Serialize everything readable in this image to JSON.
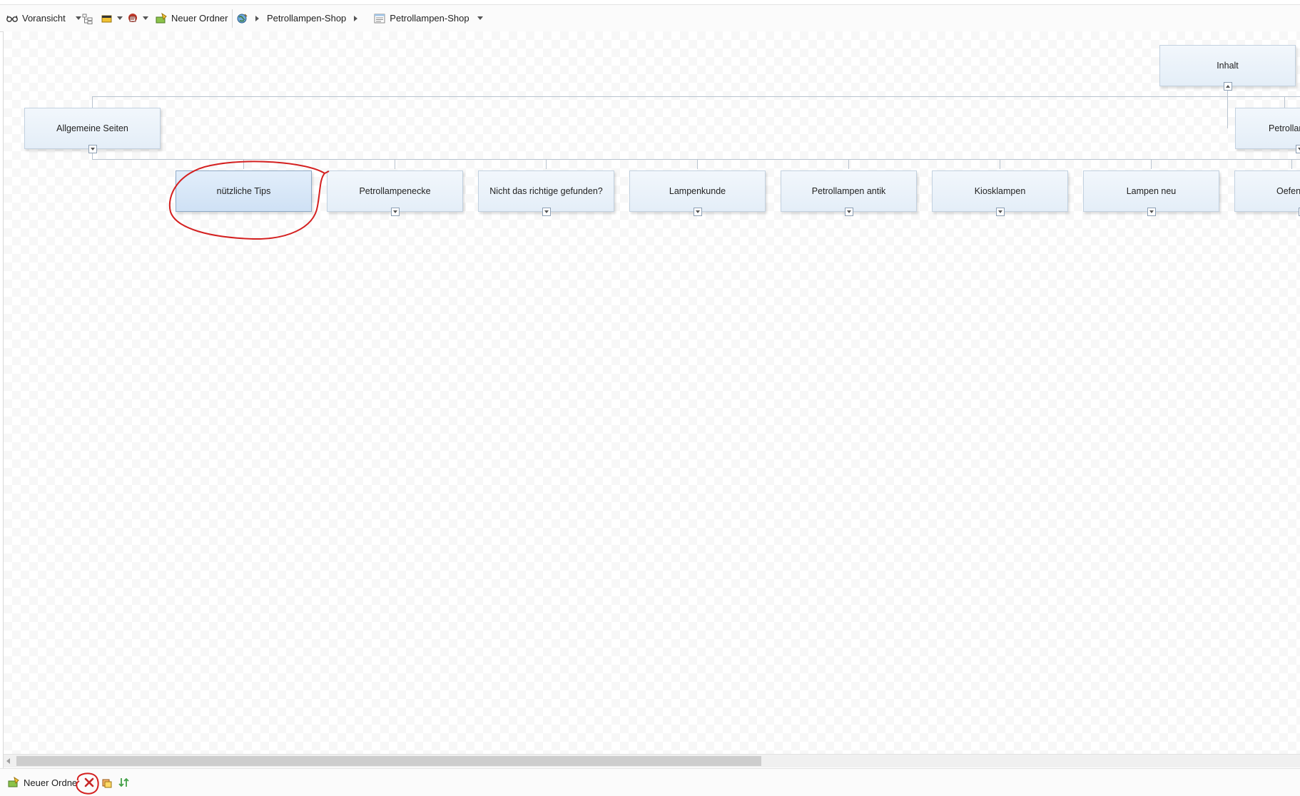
{
  "toolbar": {
    "preview_label": "Voransicht",
    "preview_icon": "glasses-icon",
    "sitemap_icon": "tree-view-icon",
    "folder_icon": "folder-icon",
    "page_icon": "page-icon",
    "new_folder_label": "Neuer Ordner",
    "new_folder_icon": "new-folder-icon",
    "breadcrumb": [
      {
        "label": "Petrollampen-Shop",
        "icon": "globe-icon"
      },
      {
        "label": "Petrollampen-Shop",
        "icon": "document-list-icon"
      }
    ]
  },
  "tree": {
    "root": {
      "label": "Inhalt"
    },
    "level1": [
      "Allgemeine Seiten",
      "Petrollam"
    ],
    "level2": [
      "nützliche Tips",
      "Petrollampenecke",
      "Nicht das richtige gefunden?",
      "Lampenkunde",
      "Petrollampen antik",
      "Kiosklampen",
      "Lampen neu",
      "Oefen"
    ],
    "selected": "nützliche Tips"
  },
  "bottombar": {
    "new_folder_label": "Neuer Ordne",
    "new_folder_icon": "new-folder-icon",
    "delete_icon": "delete-x-icon",
    "copy_icon": "copy-icon",
    "sort_icon": "sort-up-down-icon"
  },
  "annotation_color": "#d42020",
  "accent_color": "#e4eef8"
}
